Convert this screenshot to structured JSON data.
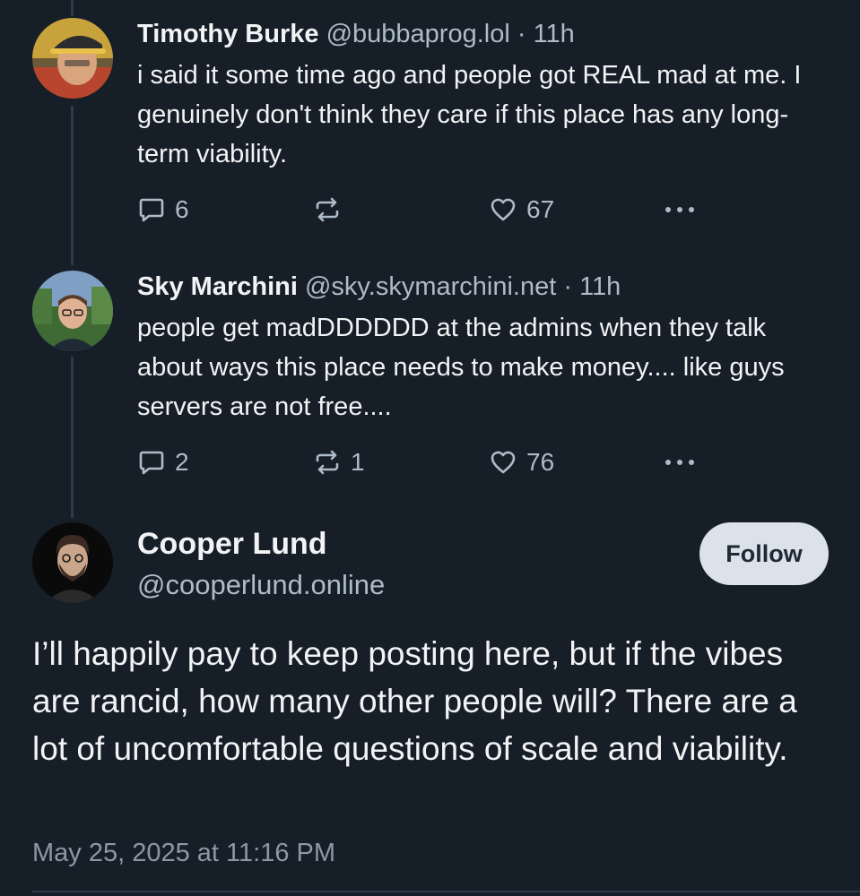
{
  "replies": [
    {
      "name": "Timothy Burke",
      "handle": "@bubbaprog.lol",
      "separator": "·",
      "time": "11h",
      "text": "i said it some time ago and people got REAL mad at me. I genuinely don't think they care if this place has any long-term viability.",
      "reply_count": "6",
      "repost_count": "",
      "like_count": "67"
    },
    {
      "name": "Sky Marchini",
      "handle": "@sky.skymarchini.net",
      "separator": "·",
      "time": "11h",
      "text": "people get madDDDDDD at the admins when they talk about ways this place needs to make money.... like guys servers are not free....",
      "reply_count": "2",
      "repost_count": "1",
      "like_count": "76"
    }
  ],
  "main_post": {
    "name": "Cooper Lund",
    "handle": "@cooperlund.online",
    "follow_label": "Follow",
    "text": "I’ll happily pay to keep posting here, but if the vibes are rancid, how many other people will? There are a lot of uncomfortable questions of scale and viability.",
    "timestamp": "May 25, 2025 at 11:16 PM"
  },
  "icons": {
    "reply": "reply-bubble-icon",
    "repost": "repost-icon",
    "like": "heart-icon",
    "more": "more-dots-icon"
  },
  "colors": {
    "background": "#161e27",
    "text_primary": "#f1f3f5",
    "text_secondary": "#aebbc9",
    "thread_line": "#2e3b49",
    "follow_button_bg": "#dce2ea"
  }
}
